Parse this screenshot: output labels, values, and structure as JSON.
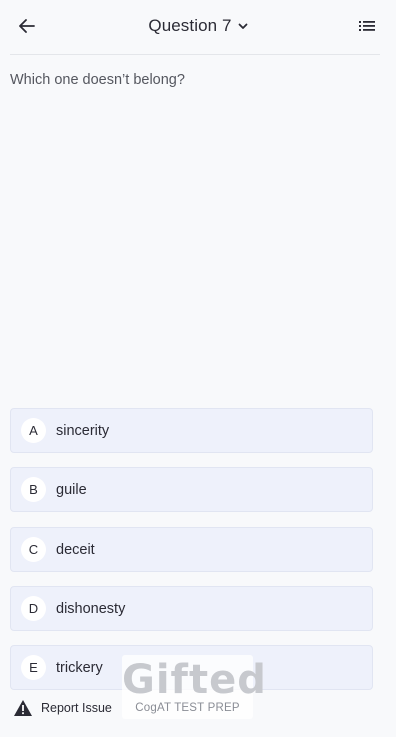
{
  "header": {
    "title": "Question 7",
    "back_icon": "arrow-left-icon",
    "dropdown_icon": "chevron-down-icon",
    "menu_icon": "list-icon"
  },
  "question": {
    "text": "Which one doesn’t belong?"
  },
  "options": [
    {
      "letter": "A",
      "text": "sincerity"
    },
    {
      "letter": "B",
      "text": "guile"
    },
    {
      "letter": "C",
      "text": "deceit"
    },
    {
      "letter": "D",
      "text": "dishonesty"
    },
    {
      "letter": "E",
      "text": "trickery"
    }
  ],
  "footer": {
    "report_label": "Report Issue",
    "report_icon": "warning-icon"
  },
  "brand": {
    "logo_text": "Gifted",
    "subtitle": "CogAT TEST PREP"
  },
  "colors": {
    "background": "#f8f9fb",
    "option_bg": "#eef1fb",
    "text": "#2b2b35"
  }
}
